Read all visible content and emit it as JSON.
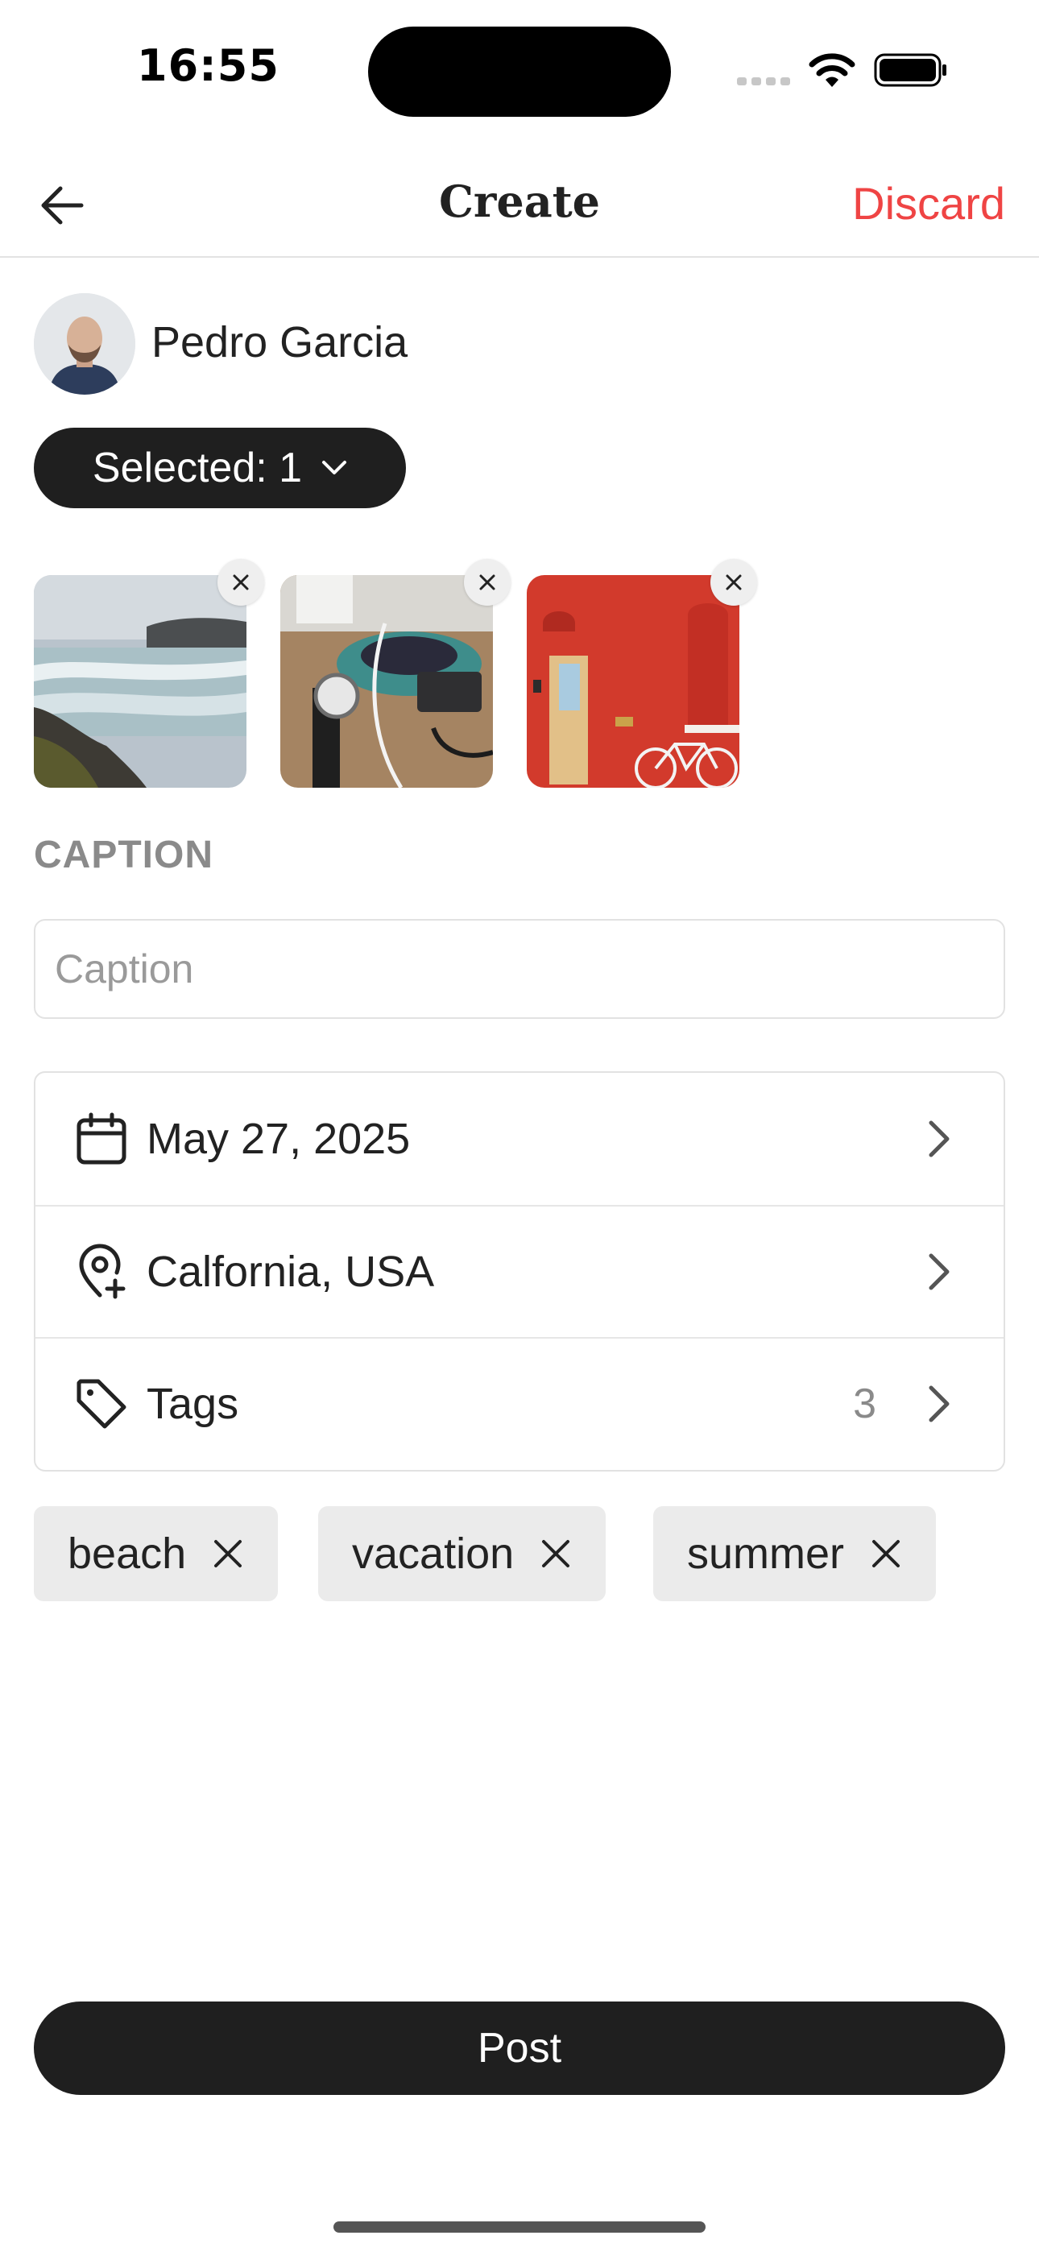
{
  "status_bar": {
    "time": "16:55"
  },
  "header": {
    "title": "Create",
    "discard_label": "Discard"
  },
  "author": {
    "name": "Pedro Garcia"
  },
  "selection": {
    "label": "Selected: 1"
  },
  "media": [
    {
      "name": "waterfall-photo"
    },
    {
      "name": "desk-watch-photo"
    },
    {
      "name": "red-wall-bicycle-photo"
    }
  ],
  "caption": {
    "section_label": "CAPTION",
    "placeholder": "Caption",
    "value": ""
  },
  "options": {
    "date": {
      "label": "May 27, 2025",
      "icon": "calendar-icon"
    },
    "location": {
      "label": "Calfornia, USA",
      "icon": "location-pin-icon"
    },
    "tags": {
      "label": "Tags",
      "count": "3",
      "icon": "tag-icon"
    }
  },
  "tags": [
    "beach",
    "vacation",
    "summer"
  ],
  "post_button": {
    "label": "Post"
  },
  "colors": {
    "accent_danger": "#ef4444",
    "primary_dark": "#1f1f1f",
    "chip_bg": "#ebebeb"
  }
}
